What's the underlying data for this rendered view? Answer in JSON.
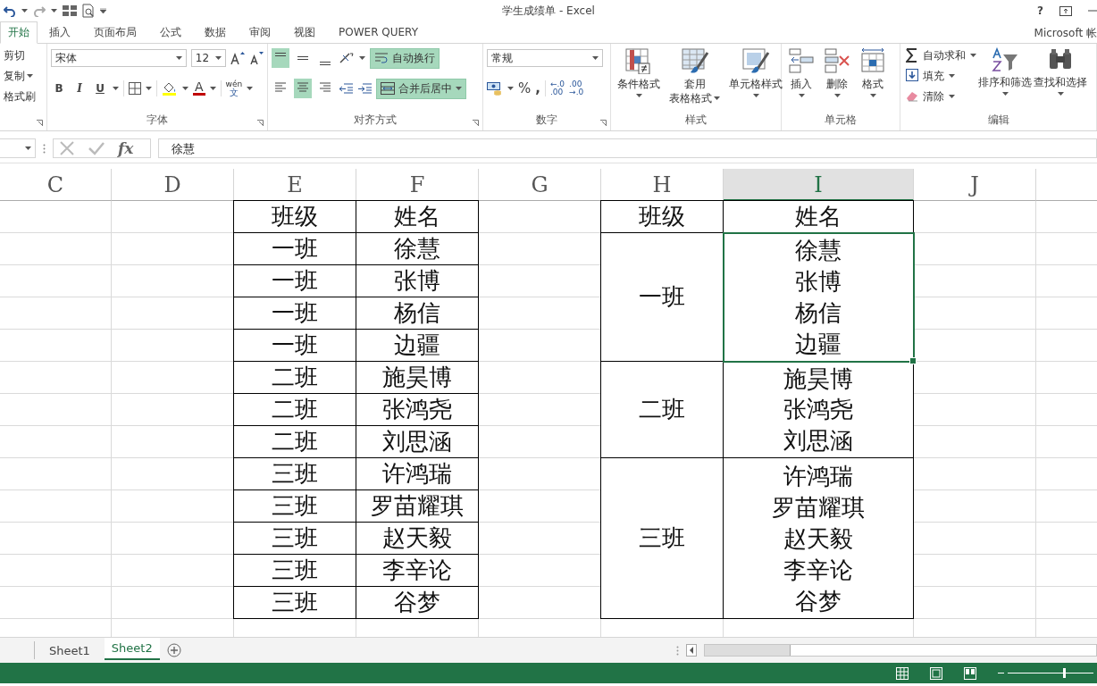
{
  "window": {
    "title": "学生成绩单 - Excel",
    "help": "?",
    "account": "Microsoft 帐"
  },
  "ribbon_tabs": [
    {
      "label": "开始",
      "selected": true
    },
    {
      "label": "插入",
      "selected": false
    },
    {
      "label": "页面布局",
      "selected": false
    },
    {
      "label": "公式",
      "selected": false
    },
    {
      "label": "数据",
      "selected": false
    },
    {
      "label": "审阅",
      "selected": false
    },
    {
      "label": "视图",
      "selected": false
    },
    {
      "label": "POWER QUERY",
      "selected": false
    }
  ],
  "clipboard": {
    "items": [
      "剪切",
      "复制",
      "格式刷"
    ]
  },
  "font": {
    "name": "宋体",
    "size": "12",
    "bold": "B",
    "italic": "I",
    "underline": "U",
    "font_color": "A",
    "phonetic_top": "wén",
    "phonetic_bottom": "文",
    "label": "字体"
  },
  "alignment": {
    "vertical": [
      {
        "kind": "top",
        "selected": true
      },
      {
        "kind": "middle",
        "selected": false
      },
      {
        "kind": "bottom",
        "selected": false
      }
    ],
    "horizontal": [
      {
        "kind": "left",
        "selected": false
      },
      {
        "kind": "center",
        "selected": true
      },
      {
        "kind": "right",
        "selected": false
      }
    ],
    "wrap": {
      "label": "自动换行",
      "selected": true
    },
    "merge": {
      "label": "合并后居中",
      "selected": true
    },
    "label": "对齐方式"
  },
  "number": {
    "format": "常规",
    "percent": "%",
    "comma": ",",
    "decimals": [
      {
        "top": "←.0",
        "bottom": ".00"
      },
      {
        "top": ".00",
        "bottom": "→.0"
      }
    ],
    "label": "数字"
  },
  "styles": {
    "buttons": [
      {
        "kind": "conditional",
        "lines": [
          "条件格式"
        ]
      },
      {
        "kind": "table",
        "lines": [
          "套用",
          "表格格式"
        ]
      },
      {
        "kind": "cell",
        "lines": [
          "单元格样式"
        ]
      }
    ],
    "label": "样式"
  },
  "cells": {
    "buttons": [
      {
        "kind": "insert",
        "label": "插入"
      },
      {
        "kind": "delete",
        "label": "删除"
      },
      {
        "kind": "format",
        "label": "格式"
      }
    ],
    "label": "单元格"
  },
  "editing": {
    "items": [
      {
        "kind": "sum",
        "label": "自动求和"
      },
      {
        "kind": "fill",
        "label": "填充"
      },
      {
        "kind": "clear",
        "label": "清除"
      }
    ],
    "buttons": [
      {
        "kind": "sort",
        "label": "排序和筛选"
      },
      {
        "kind": "find",
        "label": "查找和选择"
      }
    ],
    "label": "编辑"
  },
  "formula_bar": {
    "fx": "fx",
    "value": "徐慧"
  },
  "columns": [
    {
      "label": "C",
      "selected": false
    },
    {
      "label": "D",
      "selected": false
    },
    {
      "label": "E",
      "selected": false
    },
    {
      "label": "F",
      "selected": false
    },
    {
      "label": "G",
      "selected": false
    },
    {
      "label": "H",
      "selected": false
    },
    {
      "label": "I",
      "selected": true
    },
    {
      "label": "J",
      "selected": false
    }
  ],
  "table_1": {
    "header": [
      "班级",
      "姓名"
    ],
    "rows": [
      [
        "一班",
        "徐慧"
      ],
      [
        "一班",
        "张博"
      ],
      [
        "一班",
        "杨信"
      ],
      [
        "一班",
        "边疆"
      ],
      [
        "二班",
        "施昊博"
      ],
      [
        "二班",
        "张鸿尧"
      ],
      [
        "二班",
        "刘思涵"
      ],
      [
        "三班",
        "许鸿瑞"
      ],
      [
        "三班",
        "罗苗耀琪"
      ],
      [
        "三班",
        "赵天毅"
      ],
      [
        "三班",
        "李辛论"
      ],
      [
        "三班",
        "谷梦"
      ]
    ]
  },
  "table_2": {
    "header": [
      "班级",
      "姓名"
    ],
    "groups": [
      {
        "class": "一班",
        "names": [
          "徐慧",
          "张博",
          "杨信",
          "边疆"
        ],
        "selected": true
      },
      {
        "class": "二班",
        "names": [
          "施昊博",
          "张鸿尧",
          "刘思涵"
        ],
        "selected": false
      },
      {
        "class": "三班",
        "names": [
          "许鸿瑞",
          "罗苗耀琪",
          "赵天毅",
          "李辛论",
          "谷梦"
        ],
        "selected": false
      }
    ]
  },
  "sheet_tabs": [
    {
      "label": "Sheet1",
      "selected": false
    },
    {
      "label": "Sheet2",
      "selected": true
    }
  ],
  "zoom": {
    "level": 0.66
  }
}
